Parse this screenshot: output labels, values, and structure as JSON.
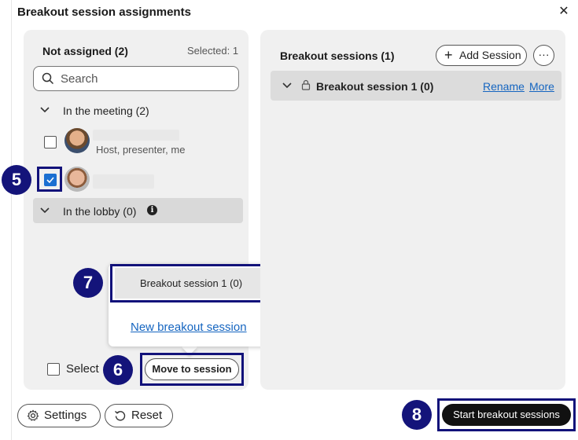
{
  "dialog": {
    "title": "Breakout session assignments",
    "close_icon": "close-icon"
  },
  "left_panel": {
    "header": "Not assigned (2)",
    "selected": "Selected: 1",
    "search": {
      "placeholder": "Search"
    },
    "groups": [
      {
        "label": "In the meeting (2)",
        "participants": [
          {
            "name_redacted": true,
            "role": "Host, presenter, me",
            "checked": false
          },
          {
            "name_redacted": true,
            "role": "",
            "checked": true
          }
        ]
      },
      {
        "label": "In the lobby (0)",
        "info_icon": "info-icon"
      }
    ],
    "popup": {
      "session_option": "Breakout session 1 (0)",
      "new_session_link": "New breakout session"
    },
    "select_all_label": "Select",
    "move_button": "Move to session"
  },
  "right_panel": {
    "title": "Breakout sessions (1)",
    "add_session": "Add Session",
    "more_options": "···",
    "sessions": [
      {
        "name": "Breakout session 1 (0)",
        "rename": "Rename",
        "more": "More"
      }
    ]
  },
  "footer": {
    "settings": "Settings",
    "reset": "Reset",
    "start": "Start breakout sessions"
  },
  "step_markers": [
    "5",
    "6",
    "7",
    "8"
  ],
  "colors": {
    "marker": "#14147a",
    "link": "#1565c0",
    "checkbox_checked": "#1b6fd1",
    "primary_button": "#111111"
  }
}
